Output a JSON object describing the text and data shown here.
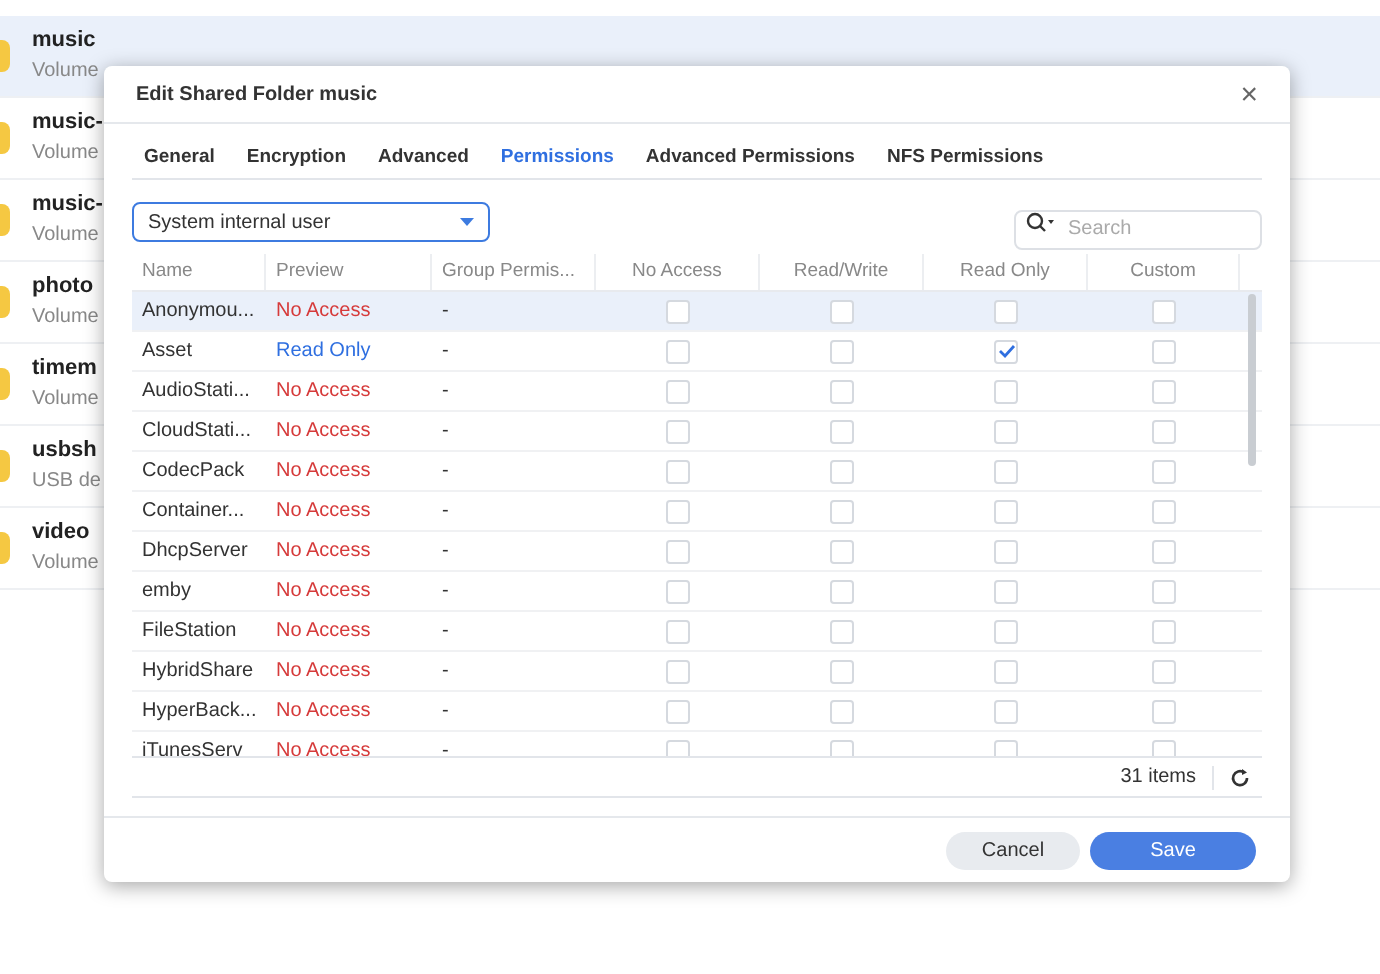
{
  "folders": [
    {
      "name": "music",
      "subtitle": "Volume",
      "selected": true
    },
    {
      "name": "music-",
      "subtitle": "Volume",
      "selected": false
    },
    {
      "name": "music-",
      "subtitle": "Volume",
      "selected": false
    },
    {
      "name": "photo",
      "subtitle": "Volume",
      "selected": false
    },
    {
      "name": "timem",
      "subtitle": "Volume",
      "selected": false
    },
    {
      "name": "usbsh",
      "subtitle": "USB de",
      "selected": false
    },
    {
      "name": "video",
      "subtitle": "Volume",
      "selected": false
    }
  ],
  "dialog": {
    "title": "Edit Shared Folder music",
    "close": "×",
    "tabs": [
      {
        "label": "General",
        "selected": false
      },
      {
        "label": "Encryption",
        "selected": false
      },
      {
        "label": "Advanced",
        "selected": false
      },
      {
        "label": "Permissions",
        "selected": true
      },
      {
        "label": "Advanced Permissions",
        "selected": false
      },
      {
        "label": "NFS Permissions",
        "selected": false
      }
    ],
    "filter": {
      "value": "System internal user"
    },
    "search": {
      "placeholder": "Search"
    },
    "table": {
      "columns": [
        "Name",
        "Preview",
        "Group Permis...",
        "No Access",
        "Read/Write",
        "Read Only",
        "Custom"
      ],
      "rows": [
        {
          "name": "Anonymou...",
          "preview": "No Access",
          "kind": "none",
          "group": "-",
          "selected": true,
          "checks": [
            false,
            false,
            false,
            false
          ]
        },
        {
          "name": "Asset",
          "preview": "Read Only",
          "kind": "read",
          "group": "-",
          "selected": false,
          "checks": [
            false,
            false,
            true,
            false
          ]
        },
        {
          "name": "AudioStati...",
          "preview": "No Access",
          "kind": "none",
          "group": "-",
          "selected": false,
          "checks": [
            false,
            false,
            false,
            false
          ]
        },
        {
          "name": "CloudStati...",
          "preview": "No Access",
          "kind": "none",
          "group": "-",
          "selected": false,
          "checks": [
            false,
            false,
            false,
            false
          ]
        },
        {
          "name": "CodecPack",
          "preview": "No Access",
          "kind": "none",
          "group": "-",
          "selected": false,
          "checks": [
            false,
            false,
            false,
            false
          ]
        },
        {
          "name": "Container...",
          "preview": "No Access",
          "kind": "none",
          "group": "-",
          "selected": false,
          "checks": [
            false,
            false,
            false,
            false
          ]
        },
        {
          "name": "DhcpServer",
          "preview": "No Access",
          "kind": "none",
          "group": "-",
          "selected": false,
          "checks": [
            false,
            false,
            false,
            false
          ]
        },
        {
          "name": "emby",
          "preview": "No Access",
          "kind": "none",
          "group": "-",
          "selected": false,
          "checks": [
            false,
            false,
            false,
            false
          ]
        },
        {
          "name": "FileStation",
          "preview": "No Access",
          "kind": "none",
          "group": "-",
          "selected": false,
          "checks": [
            false,
            false,
            false,
            false
          ]
        },
        {
          "name": "HybridShare",
          "preview": "No Access",
          "kind": "none",
          "group": "-",
          "selected": false,
          "checks": [
            false,
            false,
            false,
            false
          ]
        },
        {
          "name": "HyperBack...",
          "preview": "No Access",
          "kind": "none",
          "group": "-",
          "selected": false,
          "checks": [
            false,
            false,
            false,
            false
          ]
        },
        {
          "name": "iTunesServ",
          "preview": "No Access",
          "kind": "none",
          "group": "-",
          "selected": false,
          "checks": [
            false,
            false,
            false,
            false
          ]
        }
      ],
      "count": "31 items"
    },
    "buttons": {
      "cancel": "Cancel",
      "save": "Save"
    }
  }
}
